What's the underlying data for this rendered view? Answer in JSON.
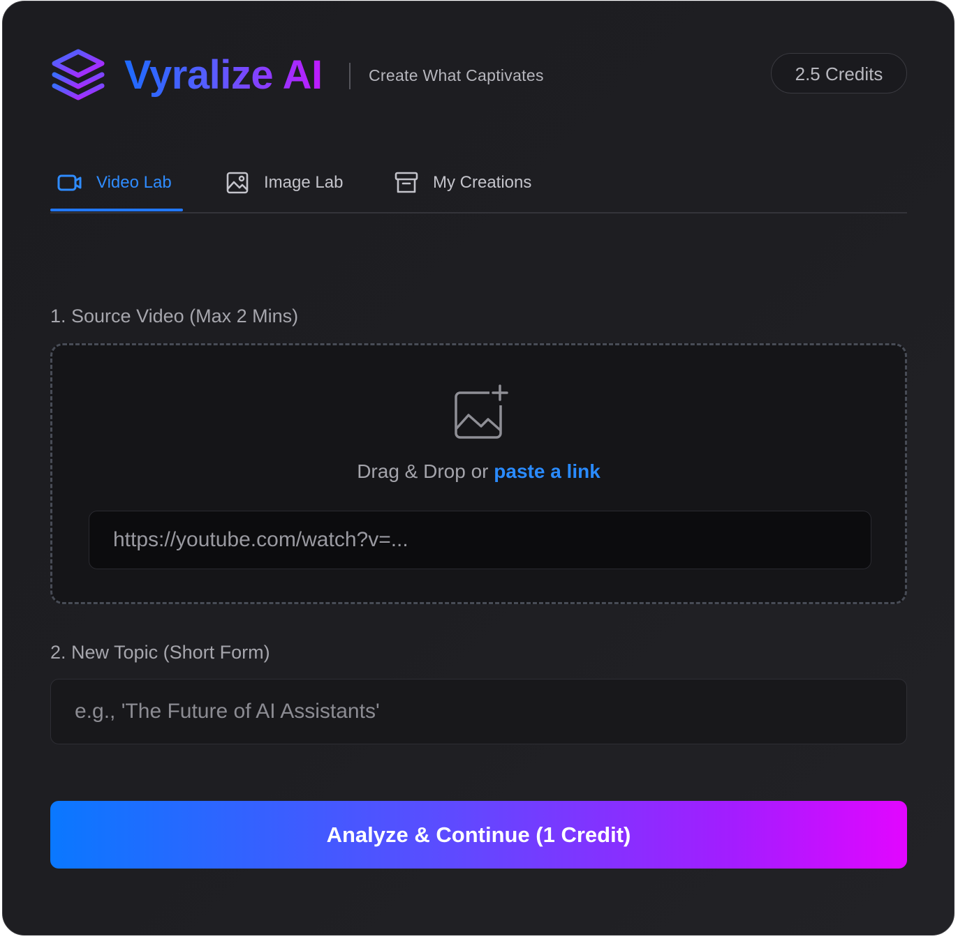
{
  "header": {
    "brand": "Vyralize AI",
    "tagline": "Create What Captivates",
    "credits": "2.5 Credits",
    "logo_icon": "layers-stack-icon"
  },
  "tabs": [
    {
      "label": "Video Lab",
      "icon": "video-camera-icon",
      "active": true
    },
    {
      "label": "Image Lab",
      "icon": "image-icon",
      "active": false
    },
    {
      "label": "My Creations",
      "icon": "archive-box-icon",
      "active": false
    }
  ],
  "source": {
    "label": "1. Source Video (Max 2 Mins)",
    "upload_icon": "image-add-icon",
    "drop_text": "Drag & Drop or ",
    "drop_link": "paste a link",
    "url_placeholder": "https://youtube.com/watch?v=..."
  },
  "topic": {
    "label": "2. New Topic (Short Form)",
    "placeholder": "e.g., 'The Future of AI Assistants'"
  },
  "cta": {
    "label": "Analyze & Continue (1 Credit)"
  },
  "colors": {
    "accent_blue": "#2f8cff",
    "accent_purple": "#c01aff",
    "background": "#1e1e22"
  }
}
